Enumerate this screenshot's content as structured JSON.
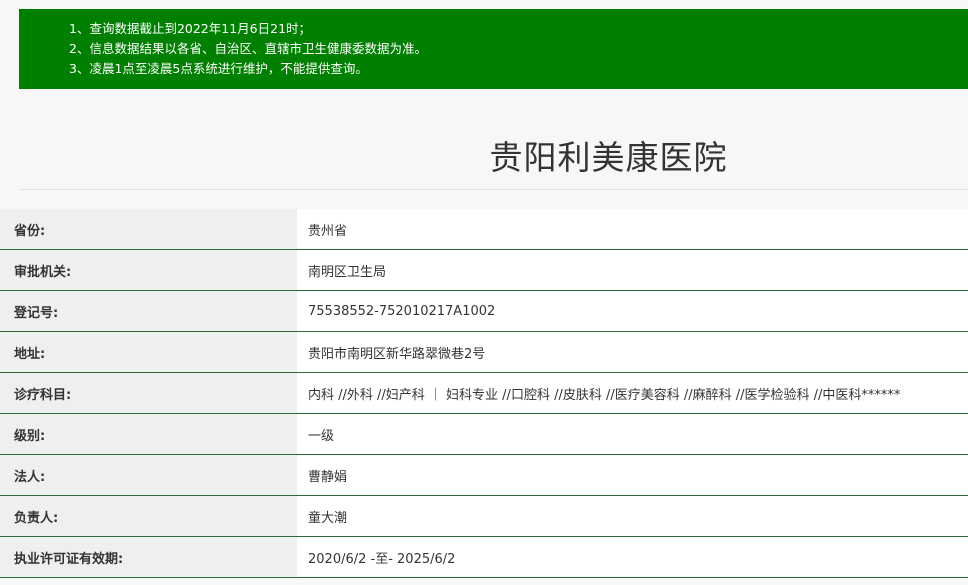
{
  "notice": {
    "lines": [
      "1、查询数据截止到2022年11月6日21时；",
      "2、信息数据结果以各省、自治区、直辖市卫生健康委数据为准。",
      "3、凌晨1点至凌晨5点系统进行维护，不能提供查询。"
    ],
    "bg_color": "#008000"
  },
  "hospital": {
    "name": "贵阳利美康医院"
  },
  "rows": [
    {
      "label": "省份:",
      "value": "贵州省"
    },
    {
      "label": "审批机关:",
      "value": "南明区卫生局"
    },
    {
      "label": "登记号:",
      "value": "75538552-752010217A1002"
    },
    {
      "label": "地址:",
      "value": "贵阳市南明区新华路翠微巷2号"
    },
    {
      "label": "诊疗科目:",
      "value": "内科 //外科 //妇产科 ｜ 妇科专业 //口腔科 //皮肤科 //医疗美容科 //麻醉科 //医学检验科 //中医科******"
    },
    {
      "label": "级别:",
      "value": "一级"
    },
    {
      "label": "法人:",
      "value": "曹静娟"
    },
    {
      "label": "负责人:",
      "value": "童大潮"
    },
    {
      "label": "执业许可证有效期:",
      "value": "2020/6/2 -至- 2025/6/2"
    }
  ]
}
